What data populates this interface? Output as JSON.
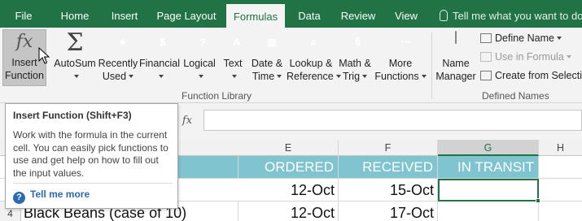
{
  "tabs": [
    {
      "label": "File",
      "active": false
    },
    {
      "label": "Home",
      "active": false
    },
    {
      "label": "Insert",
      "active": false
    },
    {
      "label": "Page Layout",
      "active": false
    },
    {
      "label": "Formulas",
      "active": true
    },
    {
      "label": "Data",
      "active": false
    },
    {
      "label": "Review",
      "active": false
    },
    {
      "label": "View",
      "active": false
    }
  ],
  "tell_me": "Tell me what you want to do...",
  "ribbon": {
    "insert_function": {
      "line1": "Insert",
      "line2": "Function",
      "icon": "fx-icon"
    },
    "autosum": {
      "line1": "AutoSum",
      "icon": "sigma-icon"
    },
    "recently_used": {
      "line1": "Recently",
      "line2": "Used",
      "icon": "star-book-icon"
    },
    "financial": {
      "line1": "Financial",
      "icon": "coins-book-icon"
    },
    "logical": {
      "line1": "Logical",
      "icon": "question-book-icon"
    },
    "text": {
      "line1": "Text",
      "icon": "text-book-icon"
    },
    "date_time": {
      "line1": "Date &",
      "line2": "Time",
      "icon": "calendar-book-icon"
    },
    "lookup_reference": {
      "line1": "Lookup &",
      "line2": "Reference",
      "icon": "magnifier-book-icon"
    },
    "math_trig": {
      "line1": "Math &",
      "line2": "Trig",
      "icon": "theta-book-icon"
    },
    "more_functions": {
      "line1": "More",
      "line2": "Functions",
      "icon": "more-book-icon"
    },
    "function_library_label": "Function Library",
    "name_manager": {
      "line1": "Name",
      "line2": "Manager",
      "icon": "name-tag-icon"
    },
    "define_name": "Define Name",
    "use_in_formula": "Use in Formula",
    "create_from_selection": "Create from Selection",
    "defined_names_label": "Defined Names"
  },
  "tooltip": {
    "title": "Insert Function (Shift+F3)",
    "body": "Work with the formula in the current cell. You can easily pick functions to use and get help on how to fill out the input values.",
    "link": "Tell me more"
  },
  "formula_bar": {
    "fx": "fx",
    "value": ""
  },
  "columns": [
    "E",
    "F",
    "G",
    "H"
  ],
  "rows": {
    "header": {
      "e": "ORDERED",
      "f": "RECEIVED",
      "g": "IN TRANSIT"
    },
    "row3": {
      "e": "12-Oct",
      "f": "15-Oct",
      "g": ""
    },
    "row4": {
      "number": "4",
      "d": "Black Beans (case of 10)",
      "e": "12-Oct",
      "f": "17-Oct",
      "g": ""
    }
  },
  "colors": {
    "ribbon_green": "#217346",
    "header_fill": "#7fc4cf"
  }
}
